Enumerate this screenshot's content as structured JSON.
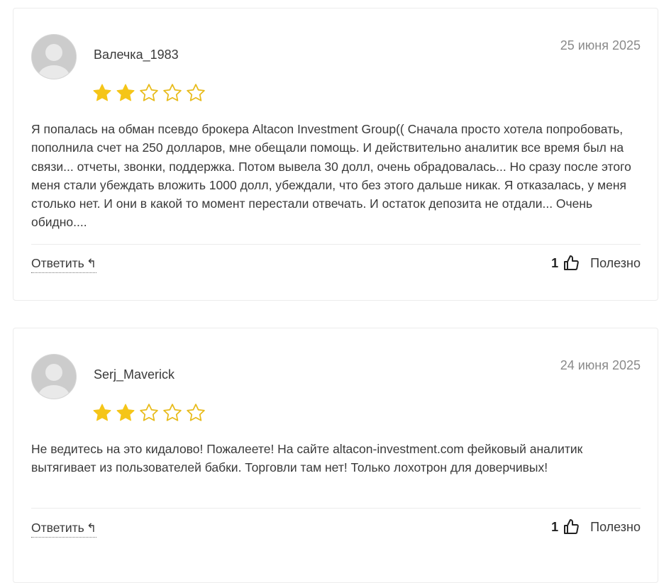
{
  "colors": {
    "star_filled": "#F5C518",
    "star_outline": "#E8BB1A",
    "avatar_bg": "#CCCCCC"
  },
  "reviews": [
    {
      "author": "Валечка_1983",
      "date": "25 июня 2025",
      "rating": 2,
      "max_rating": 5,
      "text": "Я попалась на обман псевдо брокера Altacon Investment Group(( Сначала просто хотела попробовать, пополнила счет на 250 долларов, мне обещали помощь. И действительно аналитик все время был на связи... отчеты, звонки, поддержка. Потом вывела 30 долл, очень обрадовалась... Но сразу после этого меня стали убеждать вложить 1000 долл, убеждали, что без этого дальше никак. Я отказалась, у меня столько нет. И они в какой то момент перестали отвечать. И остаток депозита не отдали... Очень обидно....",
      "reply_label": "Ответить",
      "reply_icon": "↰",
      "helpful_count": "1",
      "helpful_label": "Полезно"
    },
    {
      "author": "Serj_Maverick",
      "date": "24 июня 2025",
      "rating": 2,
      "max_rating": 5,
      "text": "Не ведитесь на это кидалово! Пожалеете! На сайте altacon-investment.com фейковый аналитик вытягивает из пользователей бабки. Торговли там нет! Только лохотрон для доверчивых!",
      "reply_label": "Ответить",
      "reply_icon": "↰",
      "helpful_count": "1",
      "helpful_label": "Полезно"
    }
  ]
}
